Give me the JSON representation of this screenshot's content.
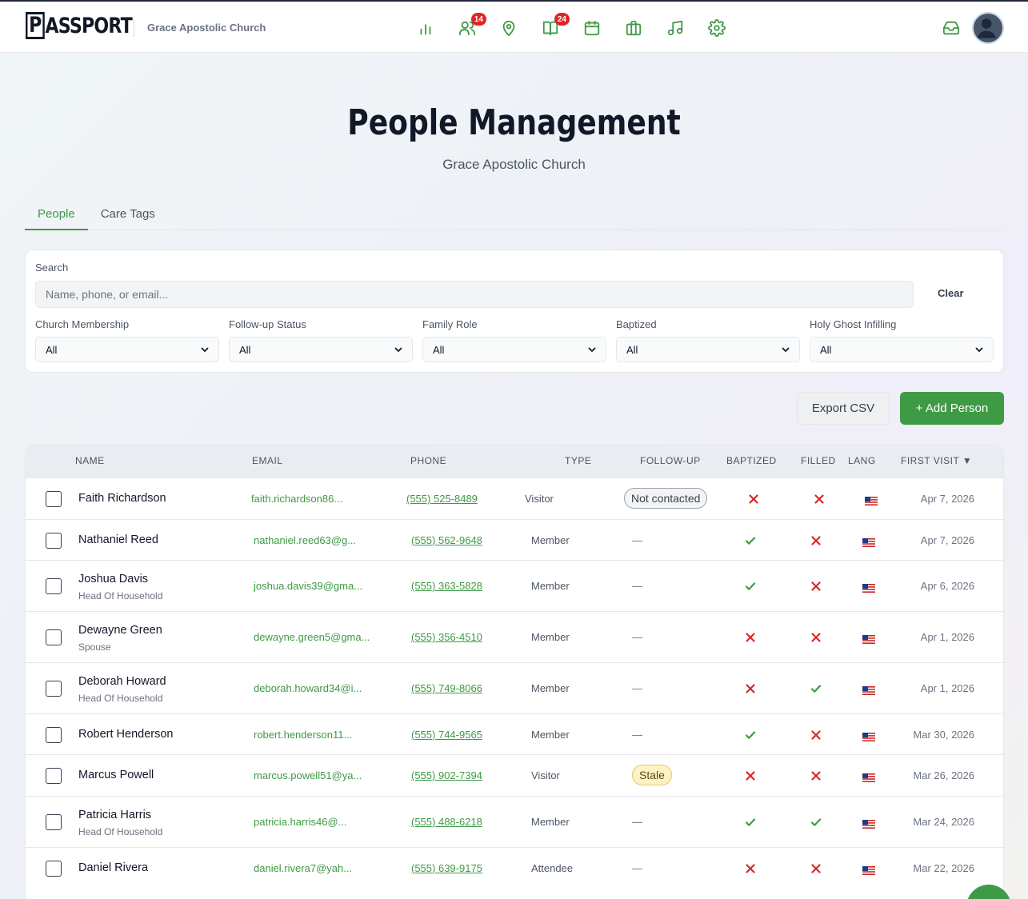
{
  "app": {
    "logo_text": "PASSPORT",
    "church_name": "Grace Apostolic Church",
    "nav": [
      {
        "icon": "bar-chart-icon"
      },
      {
        "icon": "users-icon",
        "badge": "14"
      },
      {
        "icon": "map-pin-icon"
      },
      {
        "icon": "book-open-icon",
        "badge": "24"
      },
      {
        "icon": "calendar-icon"
      },
      {
        "icon": "briefcase-icon"
      },
      {
        "icon": "music-icon"
      },
      {
        "icon": "settings-icon"
      }
    ],
    "accent_color": "#3f9a45"
  },
  "header": {
    "title": "People Management",
    "subtitle": "Grace Apostolic Church"
  },
  "tabs": [
    {
      "label": "People",
      "active": true
    },
    {
      "label": "Care Tags",
      "active": false
    }
  ],
  "filters": {
    "search_label": "Search",
    "search_placeholder": "Name, phone, or email...",
    "clear_label": "Clear",
    "selects": [
      {
        "label": "Church Membership",
        "value": "All"
      },
      {
        "label": "Follow-up Status",
        "value": "All"
      },
      {
        "label": "Family Role",
        "value": "All"
      },
      {
        "label": "Baptized",
        "value": "All"
      },
      {
        "label": "Holy Ghost Infilling",
        "value": "All"
      }
    ]
  },
  "actions": {
    "export_label": "Export CSV",
    "add_label": "+ Add Person"
  },
  "table": {
    "columns": [
      "NAME",
      "EMAIL",
      "PHONE",
      "TYPE",
      "FOLLOW-UP",
      "BAPTIZED",
      "FILLED",
      "LANG",
      "FIRST VISIT ▼"
    ],
    "rows": [
      {
        "name": "Faith Richardson",
        "role": "",
        "email": "faith.richardson86...",
        "phone": "(555) 525-8489",
        "type": "Visitor",
        "followup": "Not contacted",
        "baptized": false,
        "filled": false,
        "lang": "us-flag",
        "first_visit": "Apr 7, 2026"
      },
      {
        "name": "Nathaniel Reed",
        "role": "",
        "email": "nathaniel.reed63@g...",
        "phone": "(555) 562-9648",
        "type": "Member",
        "followup": "—",
        "baptized": true,
        "filled": false,
        "lang": "us-flag",
        "first_visit": "Apr 7, 2026"
      },
      {
        "name": "Joshua Davis",
        "role": "Head Of Household",
        "email": "joshua.davis39@gma...",
        "phone": "(555) 363-5828",
        "type": "Member",
        "followup": "—",
        "baptized": true,
        "filled": false,
        "lang": "us-flag",
        "first_visit": "Apr 6, 2026"
      },
      {
        "name": "Dewayne Green",
        "role": "Spouse",
        "email": "dewayne.green5@gma...",
        "phone": "(555) 356-4510",
        "type": "Member",
        "followup": "—",
        "baptized": false,
        "filled": false,
        "lang": "us-flag",
        "first_visit": "Apr 1, 2026"
      },
      {
        "name": "Deborah Howard",
        "role": "Head Of Household",
        "email": "deborah.howard34@i...",
        "phone": "(555) 749-8066",
        "type": "Member",
        "followup": "—",
        "baptized": false,
        "filled": true,
        "lang": "us-flag",
        "first_visit": "Apr 1, 2026"
      },
      {
        "name": "Robert Henderson",
        "role": "",
        "email": "robert.henderson11...",
        "phone": "(555) 744-9565",
        "type": "Member",
        "followup": "—",
        "baptized": true,
        "filled": false,
        "lang": "us-flag",
        "first_visit": "Mar 30, 2026"
      },
      {
        "name": "Marcus Powell",
        "role": "",
        "email": "marcus.powell51@ya...",
        "phone": "(555) 902-7394",
        "type": "Visitor",
        "followup": "Stale",
        "baptized": false,
        "filled": false,
        "lang": "us-flag",
        "first_visit": "Mar 26, 2026"
      },
      {
        "name": "Patricia Harris",
        "role": "Head Of Household",
        "email": "patricia.harris46@...",
        "phone": "(555) 488-6218",
        "type": "Member",
        "followup": "—",
        "baptized": true,
        "filled": true,
        "lang": "us-flag",
        "first_visit": "Mar 24, 2026"
      },
      {
        "name": "Daniel Rivera",
        "role": "",
        "email": "daniel.rivera7@yah...",
        "phone": "(555) 639-9175",
        "type": "Attendee",
        "followup": "—",
        "baptized": false,
        "filled": false,
        "lang": "us-flag",
        "first_visit": "Mar 22, 2026"
      }
    ]
  }
}
